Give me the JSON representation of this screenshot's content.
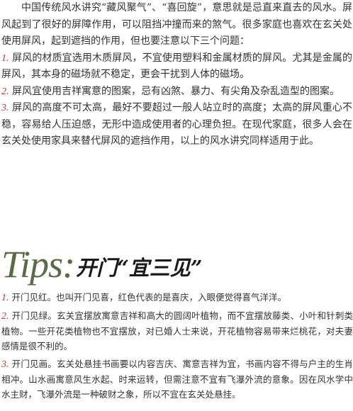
{
  "intro": {
    "opening": "中国传统风水讲究“藏风聚气”、“喜回旋”，意思就是忌直来直去的风水。屏风起到了很好的屏障作用，可以阻挡冲撞而来的煞气。很多家庭也喜欢在玄关处使用屏风，起到遮挡的作用，但也要注意以下三个问题：",
    "points": [
      {
        "num": "1.",
        "text": "屏风的材质宜选用木质屏风，不宜使用塑料和金属材质的屏风。尤其是金属的屏风，其本身的磁场就不稳定，更会干扰到人体的磁场。"
      },
      {
        "num": "2.",
        "text": "屏风宜使用吉祥寓意的图案，忌有凶煞、暴力、有尖角及杂乱造型的图案。"
      },
      {
        "num": "3.",
        "text": "屏风的高度不可太高，最好不要超过一般人站立时的高度；太高的屏风重心不稳，容易给人压迫感，无形中造成使用者的心理负担。在现代家庭，很多人会在玄关处使用家具来替代屏风的遮挡作用，以上的风水讲究同样适用于此。"
      }
    ]
  },
  "tips": {
    "label": "Tips",
    "colon": ":",
    "title": "开门“宜三见”",
    "items": [
      {
        "num": "1.",
        "text": "开门见红。也叫开门见喜，红色代表的是喜庆，入眼便觉得喜气洋洋。"
      },
      {
        "num": "2.",
        "text": "开门见绿。玄关宜摆放寓意吉祥和高大的圆阔叶植物，而不宜摆放藤类、小叶和针刺类植物。一些开花类植物也不宜摆放，对已婚人士来说，开花植物容易带来烂桃花，对夫妻感情是很不利的。"
      },
      {
        "num": "3.",
        "text": "开门见画。玄关处悬挂书画要以内容吉庆、寓意吉祥为宜，书画内容不得与户主的生肖相冲。山水画寓意风生水起、时来运转，但需注意不宜有飞瀑外流的意象。因在风水学中水主财，飞瀑外流是一种破财之象，所以不宜在玄关处悬挂。"
      }
    ]
  },
  "colors": {
    "number_accent": "#c8322a",
    "tips_label": "#5b6b45",
    "body_text": "#333333"
  }
}
